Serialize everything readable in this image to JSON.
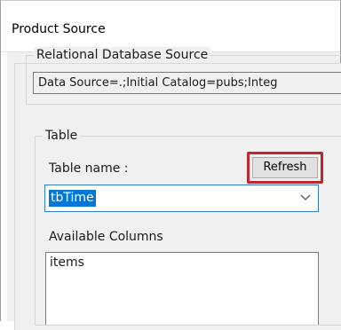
{
  "window": {
    "title": "Product Source"
  },
  "relational_source": {
    "legend": "Relational Database Source",
    "connection_string": "Data Source=.;Initial Catalog=pubs;Integ"
  },
  "table_group": {
    "legend": "Table",
    "table_name_label": "Table name :",
    "refresh_label": "Refresh",
    "table_value": "tbTime",
    "available_columns_label": "Available Columns",
    "columns": [
      "items"
    ]
  },
  "colors": {
    "highlight_border": "#c0262b",
    "selection": "#0078d7",
    "focus_border": "#2f7fd6"
  }
}
